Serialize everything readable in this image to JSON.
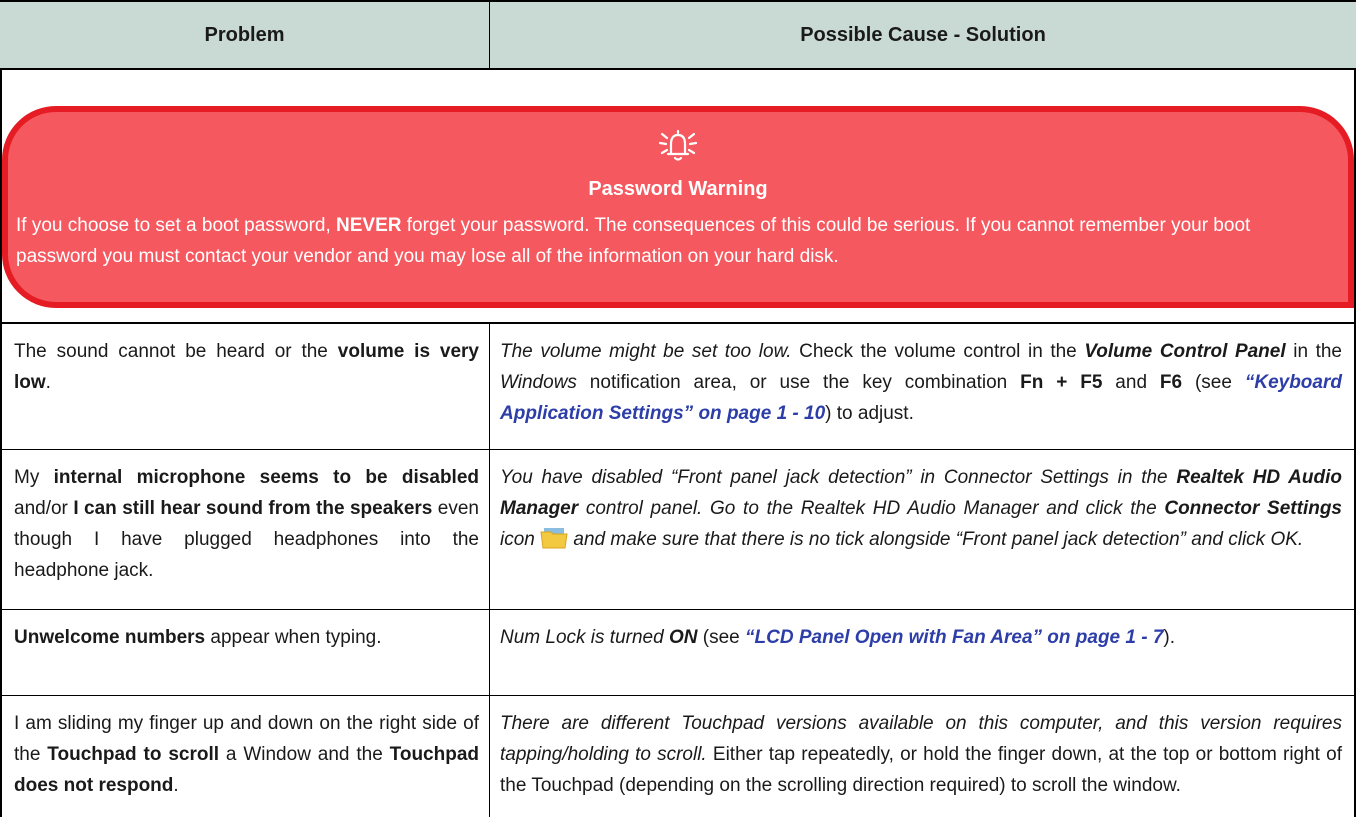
{
  "header": {
    "col_problem": "Problem",
    "col_solution": "Possible Cause - Solution"
  },
  "warning": {
    "icon": "alarm-bell-icon",
    "title": "Password Warning",
    "text_pre": "If you choose to set a boot password, ",
    "text_bold": "NEVER",
    "text_post": " forget your password. The consequences of this could be serious. If you cannot remember your boot password you must contact your vendor and you may lose all of the information on your hard disk.",
    "colors": {
      "fill": "#f5595f",
      "border": "#e51c23",
      "text": "#ffffff"
    }
  },
  "rows": [
    {
      "problem": {
        "p1": "The sound cannot be heard or the ",
        "b1": "volume is very low",
        "p2": "."
      },
      "solution": {
        "i1": "The volume might be set too low.",
        "t1": " Check the volume control in the ",
        "bi1": "Volume Control Panel",
        "t2": " in the ",
        "i2": "Windows",
        "t3": " notification area, or use the key combination ",
        "b1": "Fn + F5",
        "t4": " and ",
        "b2": "F6",
        "t5": " (see ",
        "link": "“Keyboard Application Settings” on page 1 - 10",
        "t6": ") to adjust."
      }
    },
    {
      "problem": {
        "p1": "My ",
        "b1": "internal microphone seems to be disabled",
        "p2": " and/or ",
        "b2": "I can still hear sound from the speakers",
        "p3": " even though I have plugged headphones into the headphone jack."
      },
      "solution": {
        "i1": "You have disabled “Front panel jack detection” in Connector Settings in the ",
        "bi1": "Realtek HD Audio Manager",
        "i2": " control panel. Go to the Realtek HD Audio Manager and click the ",
        "bi2": "Connector Settings",
        "i3": " icon",
        "icon": "folder-icon",
        "i4": " and make sure that there is no tick alongside “Front panel jack detection” and click OK."
      }
    },
    {
      "problem": {
        "b1": "Unwelcome numbers",
        "p1": " appear when typing."
      },
      "solution": {
        "i1": "Num Lock is turned ",
        "bi1": "ON",
        "t1": " (see ",
        "link": "“LCD Panel Open with Fan Area” on page 1 - 7",
        "t2": ")."
      }
    },
    {
      "problem": {
        "p1": "I am sliding my finger up and down on the right side of the ",
        "b1": "Touchpad to scroll",
        "p2": " a Window and the ",
        "b2": "Touchpad does not respond",
        "p3": "."
      },
      "solution": {
        "i1": "There are different Touchpad versions available on this computer, and this version requires tapping/holding to scroll.",
        "t1": " Either tap repeatedly, or hold the finger down, at the top or bottom right of the Touchpad (depending on the scrolling direction required) to scroll the window."
      }
    }
  ]
}
